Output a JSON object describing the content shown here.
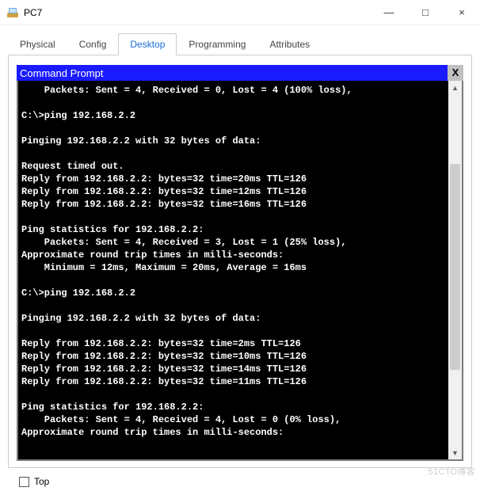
{
  "window": {
    "title": "PC7",
    "minimize": "—",
    "maximize": "□",
    "close": "×"
  },
  "tabs": {
    "items": [
      {
        "label": "Physical"
      },
      {
        "label": "Config"
      },
      {
        "label": "Desktop"
      },
      {
        "label": "Programming"
      },
      {
        "label": "Attributes"
      }
    ],
    "active_index": 2
  },
  "command_prompt": {
    "title": "Command Prompt",
    "close_label": "X",
    "lines": [
      "    Packets: Sent = 4, Received = 0, Lost = 4 (100% loss),",
      "",
      "C:\\>ping 192.168.2.2",
      "",
      "Pinging 192.168.2.2 with 32 bytes of data:",
      "",
      "Request timed out.",
      "Reply from 192.168.2.2: bytes=32 time=20ms TTL=126",
      "Reply from 192.168.2.2: bytes=32 time=12ms TTL=126",
      "Reply from 192.168.2.2: bytes=32 time=16ms TTL=126",
      "",
      "Ping statistics for 192.168.2.2:",
      "    Packets: Sent = 4, Received = 3, Lost = 1 (25% loss),",
      "Approximate round trip times in milli-seconds:",
      "    Minimum = 12ms, Maximum = 20ms, Average = 16ms",
      "",
      "C:\\>ping 192.168.2.2",
      "",
      "Pinging 192.168.2.2 with 32 bytes of data:",
      "",
      "Reply from 192.168.2.2: bytes=32 time=2ms TTL=126",
      "Reply from 192.168.2.2: bytes=32 time=10ms TTL=126",
      "Reply from 192.168.2.2: bytes=32 time=14ms TTL=126",
      "Reply from 192.168.2.2: bytes=32 time=11ms TTL=126",
      "",
      "Ping statistics for 192.168.2.2:",
      "    Packets: Sent = 4, Received = 4, Lost = 0 (0% loss),",
      "Approximate round trip times in milli-seconds:"
    ]
  },
  "footer": {
    "top_label": "Top"
  },
  "watermark": "51CTO博客"
}
